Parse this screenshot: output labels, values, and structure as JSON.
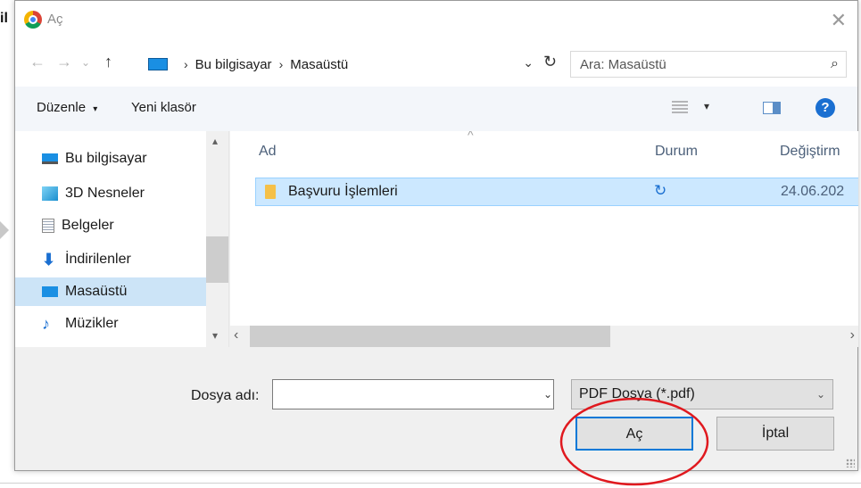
{
  "background": {
    "left_text": "il"
  },
  "dialog": {
    "title": "Aç",
    "icons": {
      "app": "chrome-icon",
      "close": "close-icon"
    },
    "colors": {
      "selection": "#cce4f7",
      "row_highlight": "#cce8ff",
      "accent": "#0078d7",
      "annotation": "#e0191f"
    }
  },
  "navigation": {
    "breadcrumb": [
      "Bu bilgisayar",
      "Masaüstü"
    ],
    "search_placeholder": "Ara: Masaüstü"
  },
  "toolbar": {
    "organize": "Düzenle",
    "new_folder": "Yeni klasör"
  },
  "sidebar": {
    "items": [
      {
        "label": "Bu bilgisayar",
        "icon": "computer-icon"
      },
      {
        "label": "3D Nesneler",
        "icon": "cube-3d-icon"
      },
      {
        "label": "Belgeler",
        "icon": "document-icon"
      },
      {
        "label": "İndirilenler",
        "icon": "download-arrow-icon"
      },
      {
        "label": "Masaüstü",
        "icon": "desktop-icon",
        "selected": true
      },
      {
        "label": "Müzikler",
        "icon": "music-note-icon"
      }
    ]
  },
  "file_list": {
    "columns": [
      "Ad",
      "Durum",
      "Değiştirm"
    ],
    "rows": [
      {
        "name": "Başvuru İşlemleri",
        "status_icon": "sync-icon",
        "modified": "24.06.202"
      }
    ]
  },
  "footer": {
    "filename_label": "Dosya adı:",
    "filename_value": "",
    "filter_value": "PDF Dosya (*.pdf)",
    "open_button": "Aç",
    "cancel_button": "İptal"
  }
}
